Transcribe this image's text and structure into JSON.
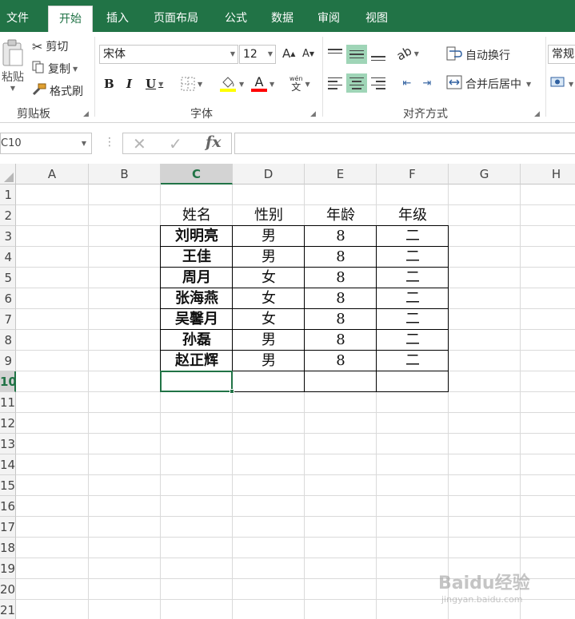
{
  "tabs": [
    {
      "label": "文件"
    },
    {
      "label": "开始"
    },
    {
      "label": "插入"
    },
    {
      "label": "页面布局"
    },
    {
      "label": "公式"
    },
    {
      "label": "数据"
    },
    {
      "label": "审阅"
    },
    {
      "label": "视图"
    }
  ],
  "ribbon": {
    "clipboard": {
      "paste": "粘贴",
      "cut": "剪切",
      "copy": "复制",
      "format_painter": "格式刷",
      "label": "剪贴板"
    },
    "font": {
      "font_name": "宋体",
      "font_size": "12",
      "grow": "A",
      "shrink": "A",
      "bold": "B",
      "italic": "I",
      "underline": "U",
      "font_color_letter": "A",
      "phonetic_top": "wén",
      "phonetic_bottom": "文",
      "label": "字体"
    },
    "alignment": {
      "wrap_text": "自动换行",
      "merge_center": "合并后居中",
      "label": "对齐方式"
    },
    "number": {
      "format": "常规"
    }
  },
  "formula_bar": {
    "name_box": "C10",
    "fx": "fx",
    "value": ""
  },
  "columns": [
    "A",
    "B",
    "C",
    "D",
    "E",
    "F",
    "G",
    "H"
  ],
  "rows": [
    "1",
    "2",
    "3",
    "4",
    "5",
    "6",
    "7",
    "8",
    "9",
    "10",
    "11",
    "12",
    "13",
    "14",
    "15",
    "16",
    "17",
    "18",
    "19",
    "20",
    "21"
  ],
  "selected_cell": "C10",
  "table": {
    "headers": [
      "姓名",
      "性别",
      "年龄",
      "年级"
    ],
    "rows": [
      [
        "刘明亮",
        "男",
        "8",
        "二"
      ],
      [
        "王佳",
        "男",
        "8",
        "二"
      ],
      [
        "周月",
        "女",
        "8",
        "二"
      ],
      [
        "张海燕",
        "女",
        "8",
        "二"
      ],
      [
        "吴馨月",
        "女",
        "8",
        "二"
      ],
      [
        "孙磊",
        "男",
        "8",
        "二"
      ],
      [
        "赵正辉",
        "男",
        "8",
        "二"
      ]
    ]
  },
  "colors": {
    "accent": "#217346",
    "highlight_fill": "#ffff00",
    "font_color": "#ff0000",
    "align_selected": "#9fd5b7"
  },
  "watermark": {
    "brand": "Baidu经验",
    "url": "jingyan.baidu.com"
  }
}
